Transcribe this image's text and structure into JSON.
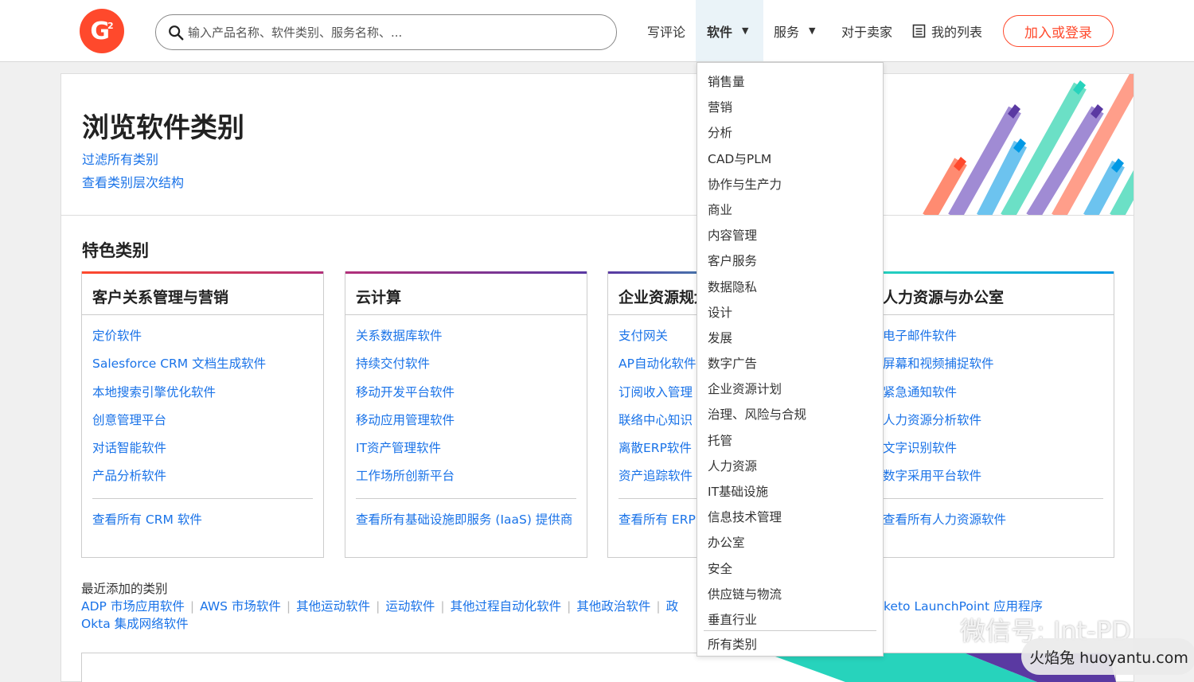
{
  "header": {
    "logo_text": "G",
    "logo_sup": "2",
    "search_placeholder": "输入产品名称、软件类别、服务名称、...",
    "nav": [
      "写评论",
      "软件",
      "服务",
      "对于卖家",
      "我的列表"
    ],
    "join_label": "加入或登录"
  },
  "hero": {
    "title": "浏览软件类别",
    "links": [
      "过滤所有类别",
      "查看类别层次结构"
    ]
  },
  "featured": {
    "title": "特色类别",
    "cards": [
      {
        "title": "客户关系管理与营销",
        "accent": "#ff492c",
        "items": [
          "定价软件",
          "Salesforce CRM 文档生成软件",
          "本地搜索引擎优化软件",
          "创意管理平台",
          "对话智能软件",
          "产品分析软件"
        ],
        "all": "查看所有 CRM 软件"
      },
      {
        "title": "云计算",
        "accent": "#5a39a2",
        "items": [
          "关系数据库软件",
          "持续交付软件",
          "移动开发平台软件",
          "移动应用管理软件",
          "IT资产管理软件",
          "工作场所创新平台"
        ],
        "all": "查看所有基础设施即服务 (IaaS) 提供商"
      },
      {
        "title": "企业资源规划",
        "accent": "#27d3bc",
        "items": [
          "支付网关",
          "AP自动化软件",
          "订阅收入管理",
          "联络中心知识",
          "离散ERP软件",
          "资产追踪软件"
        ],
        "all": "查看所有 ERP"
      },
      {
        "title": "人力资源与办公室",
        "accent": "#0099e5",
        "items": [
          "电子邮件软件",
          "屏幕和视频捕捉软件",
          "紧急通知软件",
          "人力资源分析软件",
          "文字识别软件",
          "数字采用平台软件"
        ],
        "all": "查看所有人力资源软件"
      }
    ]
  },
  "recent": {
    "label": "最近添加的类别",
    "items": [
      "ADP 市场应用软件",
      "AWS 市场软件",
      "其他运动软件",
      "运动软件",
      "其他过程自动化软件",
      "其他政治软件",
      "政",
      "keto LaunchPoint 应用程序"
    ],
    "line2": "Okta 集成网络软件"
  },
  "dropdown": {
    "items": [
      "销售量",
      "营销",
      "分析",
      "CAD与PLM",
      "协作与生产力",
      "商业",
      "内容管理",
      "客户服务",
      "数据隐私",
      "设计",
      "发展",
      "数字广告",
      "企业资源计划",
      "治理、风险与合规",
      "托管",
      "人力资源",
      "IT基础设施",
      "信息技术管理",
      "办公室",
      "安全",
      "供应链与物流",
      "垂直行业"
    ],
    "all": "所有类别"
  },
  "watermark": {
    "line1": "微信号: Int-PD",
    "pill": "火焰兔 huoyantu.com"
  },
  "colors": {
    "brand": "#ff492c",
    "link": "#1a73e8",
    "purple": "#5a39a2",
    "teal": "#27d3bc",
    "blue": "#0099e5",
    "salmon": "#ff8b71"
  }
}
